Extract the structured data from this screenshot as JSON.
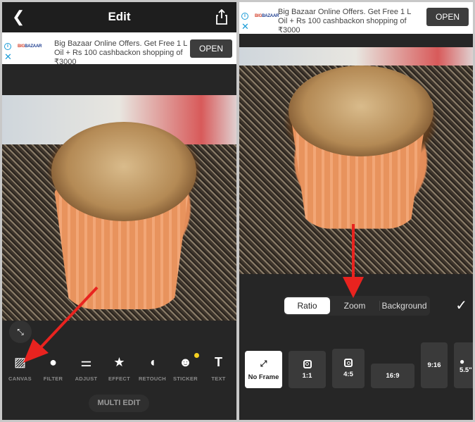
{
  "left": {
    "header": {
      "title": "Edit",
      "back_icon": "chevron-left-icon",
      "share_icon": "share-icon"
    },
    "ad": {
      "brand": "BIG BAZAAR",
      "text": "Big Bazaar Online Offers. Get Free 1 L Oil + Rs 100 cashbackon shopping of ₹3000",
      "open_label": "OPEN"
    },
    "tools": [
      {
        "label": "CANVAS",
        "icon": "canvas-icon"
      },
      {
        "label": "FILTER",
        "icon": "filter-icon"
      },
      {
        "label": "ADJUST",
        "icon": "adjust-icon"
      },
      {
        "label": "EFFECT",
        "icon": "star-icon"
      },
      {
        "label": "RETOUCH",
        "icon": "retouch-icon"
      },
      {
        "label": "STICKER",
        "icon": "smiley-icon",
        "badge": true
      },
      {
        "label": "TEXT",
        "icon": "text-icon"
      }
    ],
    "multi_edit": "MULTI EDIT"
  },
  "right": {
    "ad": {
      "brand": "BIG BAZAAR",
      "text": "Big Bazaar Online Offers. Get Free 1 L Oil + Rs 100 cashbackon shopping of ₹3000",
      "open_label": "OPEN"
    },
    "tabs": [
      {
        "label": "Ratio",
        "active": true
      },
      {
        "label": "Zoom"
      },
      {
        "label": "Background"
      }
    ],
    "ratios": [
      {
        "label": "No Frame",
        "selected": true
      },
      {
        "label": "1:1"
      },
      {
        "label": "4:5"
      },
      {
        "label": "16:9"
      },
      {
        "label": "9:16"
      },
      {
        "label": "5.5\""
      }
    ]
  },
  "colors": {
    "accent_arrow": "#e8231f",
    "badge": "#f5d020",
    "panel": "#262626"
  }
}
